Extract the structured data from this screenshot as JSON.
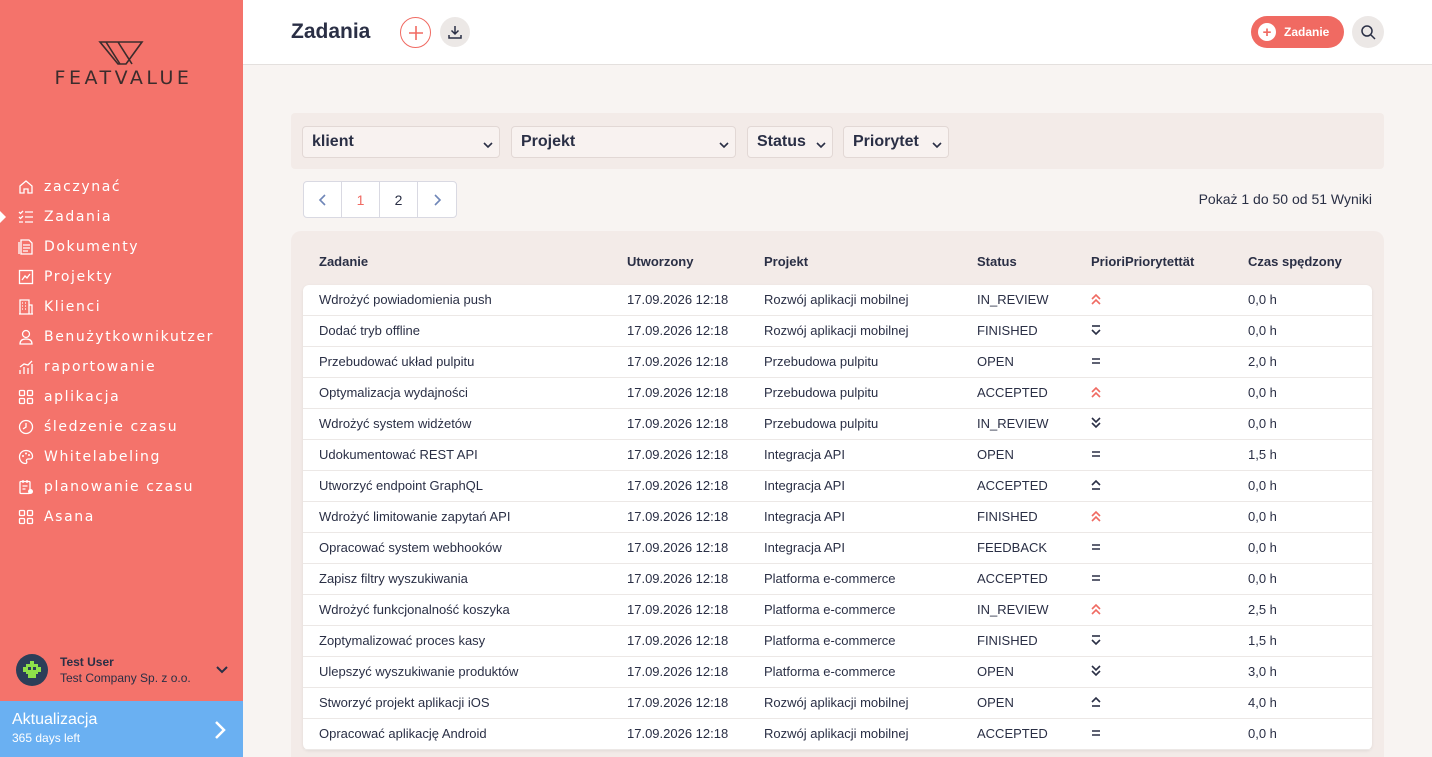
{
  "app": {
    "logo_text": "FEATVALUE",
    "brand_color": "#f4736b",
    "accent_color": "#f06a62"
  },
  "sidebar": {
    "items": [
      {
        "label": "zaczynać",
        "icon": "home-icon"
      },
      {
        "label": "Zadania",
        "icon": "tasks-icon",
        "active": true
      },
      {
        "label": "Dokumenty",
        "icon": "documents-icon"
      },
      {
        "label": "Projekty",
        "icon": "projects-icon"
      },
      {
        "label": "Klienci",
        "icon": "building-icon"
      },
      {
        "label": "Benużytkownikutzer",
        "icon": "user-icon"
      },
      {
        "label": "raportowanie",
        "icon": "chart-icon"
      },
      {
        "label": "aplikacja",
        "icon": "apps-icon"
      },
      {
        "label": "śledzenie czasu",
        "icon": "timer-icon"
      },
      {
        "label": "Whitelabeling",
        "icon": "palette-icon"
      },
      {
        "label": "planowanie czasu",
        "icon": "planning-icon"
      },
      {
        "label": "Asana",
        "icon": "apps-icon"
      }
    ],
    "user": {
      "name": "Test User",
      "company": "Test Company Sp. z o.o."
    },
    "upgrade": {
      "title": "Aktualizacja",
      "subtitle": "365 days left"
    }
  },
  "header": {
    "title": "Zadania",
    "new_button_label": "Zadanie"
  },
  "filters": {
    "client": "klient",
    "project": "Projekt",
    "status": "Status",
    "priority": "Priorytet"
  },
  "pagination": {
    "pages": [
      "1",
      "2"
    ],
    "current": "1",
    "results_text": "Pokaż 1 do 50 od 51 Wyniki"
  },
  "table": {
    "columns": [
      "Zadanie",
      "Utworzony",
      "Projekt",
      "Status",
      "PrioriPriorytettät",
      "Czas spędzony"
    ],
    "rows": [
      {
        "task": "Wdrożyć powiadomienia push",
        "created": "17.09.2026 12:18",
        "project": "Rozwój aplikacji mobilnej",
        "status": "IN_REVIEW",
        "priority": "highest",
        "time": "0,0 h"
      },
      {
        "task": "Dodać tryb offline",
        "created": "17.09.2026 12:18",
        "project": "Rozwój aplikacji mobilnej",
        "status": "FINISHED",
        "priority": "low",
        "time": "0,0 h"
      },
      {
        "task": "Przebudować układ pulpitu",
        "created": "17.09.2026 12:18",
        "project": "Przebudowa pulpitu",
        "status": "OPEN",
        "priority": "medium",
        "time": "2,0 h"
      },
      {
        "task": "Optymalizacja wydajności",
        "created": "17.09.2026 12:18",
        "project": "Przebudowa pulpitu",
        "status": "ACCEPTED",
        "priority": "highest",
        "time": "0,0 h"
      },
      {
        "task": "Wdrożyć system widżetów",
        "created": "17.09.2026 12:18",
        "project": "Przebudowa pulpitu",
        "status": "IN_REVIEW",
        "priority": "lowest",
        "time": "0,0 h"
      },
      {
        "task": "Udokumentować REST API",
        "created": "17.09.2026 12:18",
        "project": "Integracja API",
        "status": "OPEN",
        "priority": "medium",
        "time": "1,5 h"
      },
      {
        "task": "Utworzyć endpoint GraphQL",
        "created": "17.09.2026 12:18",
        "project": "Integracja API",
        "status": "ACCEPTED",
        "priority": "high",
        "time": "0,0 h"
      },
      {
        "task": "Wdrożyć limitowanie zapytań API",
        "created": "17.09.2026 12:18",
        "project": "Integracja API",
        "status": "FINISHED",
        "priority": "highest",
        "time": "0,0 h"
      },
      {
        "task": "Opracować system webhooków",
        "created": "17.09.2026 12:18",
        "project": "Integracja API",
        "status": "FEEDBACK",
        "priority": "medium",
        "time": "0,0 h"
      },
      {
        "task": "Zapisz filtry wyszukiwania",
        "created": "17.09.2026 12:18",
        "project": "Platforma e-commerce",
        "status": "ACCEPTED",
        "priority": "medium",
        "time": "0,0 h"
      },
      {
        "task": "Wdrożyć funkcjonalność koszyka",
        "created": "17.09.2026 12:18",
        "project": "Platforma e-commerce",
        "status": "IN_REVIEW",
        "priority": "highest",
        "time": "2,5 h"
      },
      {
        "task": "Zoptymalizować proces kasy",
        "created": "17.09.2026 12:18",
        "project": "Platforma e-commerce",
        "status": "FINISHED",
        "priority": "low",
        "time": "1,5 h"
      },
      {
        "task": "Ulepszyć wyszukiwanie produktów",
        "created": "17.09.2026 12:18",
        "project": "Platforma e-commerce",
        "status": "OPEN",
        "priority": "lowest",
        "time": "3,0 h"
      },
      {
        "task": "Stworzyć projekt aplikacji iOS",
        "created": "17.09.2026 12:18",
        "project": "Rozwój aplikacji mobilnej",
        "status": "OPEN",
        "priority": "high",
        "time": "4,0 h"
      },
      {
        "task": "Opracować aplikację Android",
        "created": "17.09.2026 12:18",
        "project": "Rozwój aplikacji mobilnej",
        "status": "ACCEPTED",
        "priority": "medium",
        "time": "0,0 h"
      }
    ]
  }
}
